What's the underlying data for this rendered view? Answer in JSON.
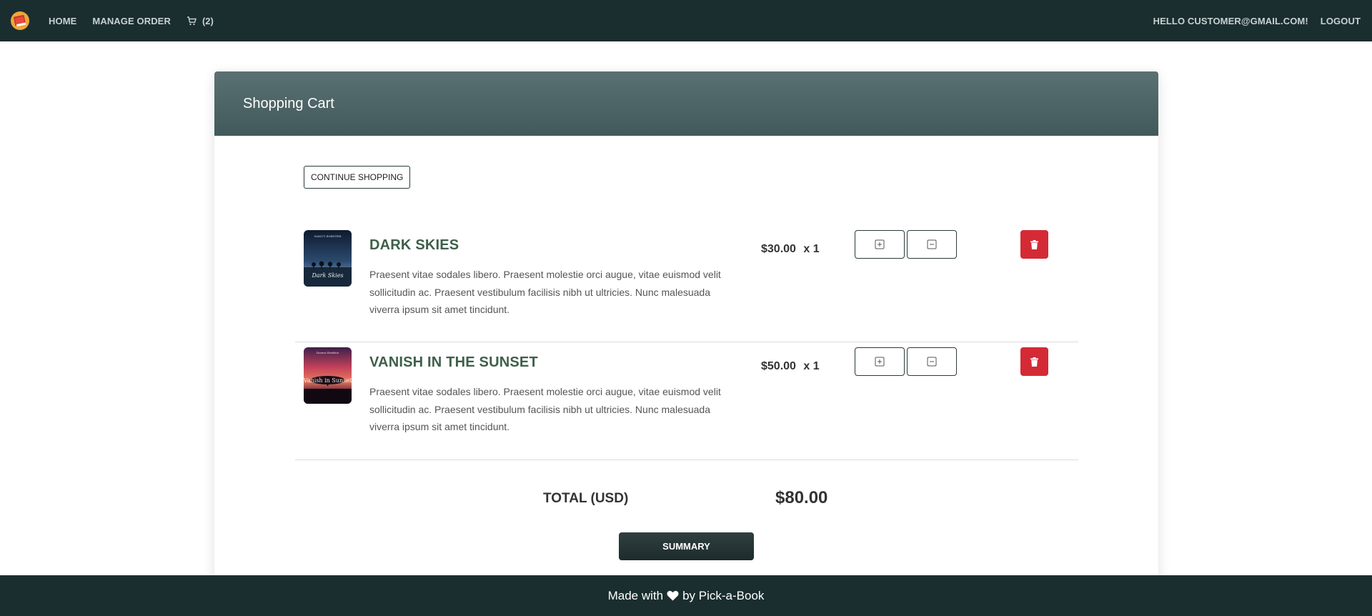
{
  "nav": {
    "home_label": "HOME",
    "manage_order_label": "MANAGE ORDER",
    "cart_count": "(2)",
    "greeting": "HELLO CUSTOMER@GMAIL.COM!",
    "logout_label": "LOGOUT"
  },
  "card": {
    "title": "Shopping Cart",
    "continue_label": "CONTINUE SHOPPING"
  },
  "items": [
    {
      "title": "DARK SKIES",
      "description": "Praesent vitae sodales libero. Praesent molestie orci augue, vitae euismod velit sollicitudin ac. Praesent vestibulum facilisis nibh ut ultricies. Nunc malesuada viverra ipsum sit amet tincidunt.",
      "price": "$30.00",
      "quantity": "x 1",
      "cover_text": "Dark Skies",
      "cover_author": "NANCY ROBSTER"
    },
    {
      "title": "VANISH IN THE SUNSET",
      "description": "Praesent vitae sodales libero. Praesent molestie orci augue, vitae euismod velit sollicitudin ac. Praesent vestibulum facilisis nibh ut ultricies. Nunc malesuada viverra ipsum sit amet tincidunt.",
      "price": "$50.00",
      "quantity": "x 1",
      "cover_text": "Vanish in Sunset",
      "cover_author": "Donna Stratton"
    }
  ],
  "total": {
    "label": "TOTAL (USD)",
    "value": "$80.00"
  },
  "summary_label": "SUMMARY",
  "footer": {
    "made_with": "Made with",
    "by": "by Pick-a-Book"
  },
  "colors": {
    "nav_bg": "#1b2e2f",
    "header_gradient_top": "#5a7173",
    "book_title": "#3e5f4a",
    "delete_red": "#d42a36"
  },
  "icons": [
    "book-logo-icon",
    "cart-icon",
    "plus-square-icon",
    "minus-square-icon",
    "trash-icon",
    "heart-icon"
  ]
}
